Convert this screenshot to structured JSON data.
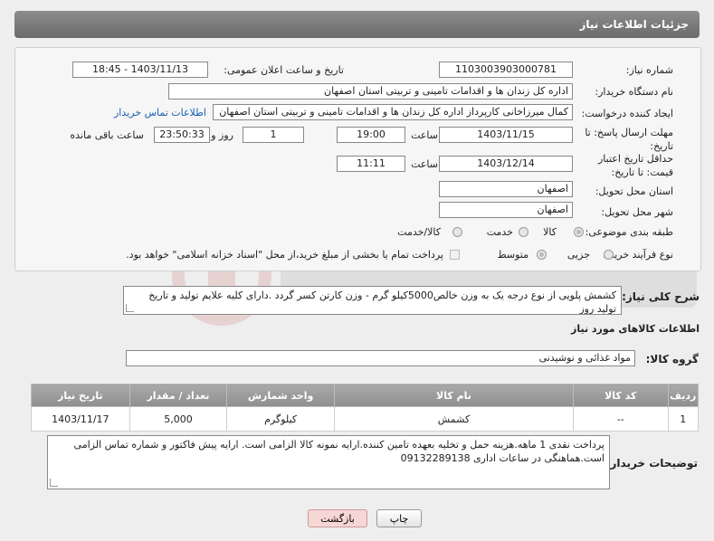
{
  "header": {
    "title": "جزئیات اطلاعات نیاز"
  },
  "form": {
    "need_number_label": "شماره نیاز:",
    "need_number": "1103003903000781",
    "announce_label": "تاریخ و ساعت اعلان عمومی:",
    "announce_value": "1403/11/13 - 18:45",
    "buyer_org_label": "نام دستگاه خریدار:",
    "buyer_org": "اداره کل زندان ها و اقدامات تامینی و تربیتی استان اصفهان",
    "creator_label": "ایجاد کننده درخواست:",
    "creator": "کمال میرزاخانی کارپرداز اداره کل زندان ها و اقدامات تامینی و تربیتی استان اصفهان",
    "contact_link": "اطلاعات تماس خریدار",
    "deadline_label": "مهلت ارسال پاسخ: تا تاریخ:",
    "deadline_date": "1403/11/15",
    "time_label": "ساعت",
    "deadline_time": "19:00",
    "days_value": "1",
    "days_label": "روز و",
    "remaining_value": "23:50:33",
    "remaining_label": "ساعت باقی مانده",
    "validity_label": "حداقل تاریخ اعتبار قیمت: تا تاریخ:",
    "validity_date": "1403/12/14",
    "validity_time": "11:11",
    "province_label": "استان محل تحویل:",
    "province": "اصفهان",
    "city_label": "شهر محل تحویل:",
    "city": "اصفهان",
    "category_label": "طبقه بندی موضوعی:",
    "category_options": [
      "کالا",
      "خدمت",
      "کالا/خدمت"
    ],
    "purchase_type_label": "نوع فرآیند خرید :",
    "purchase_type_options": [
      "جزیی",
      "متوسط"
    ],
    "payment_note": "پرداخت تمام یا بخشی از مبلغ خرید،از محل \"اسناد خزانه اسلامی\" خواهد بود."
  },
  "description": {
    "label": "شرح کلی نیاز:",
    "text": "کشمش پلویی از نوع درجه یک به وزن خالص5000کیلو گرم - وزن کارتن کسر گردد .دارای کلیه علایم تولید و تاریخ تولید روز"
  },
  "goods_info": {
    "title": "اطلاعات کالاهای مورد نیاز",
    "group_label": "گروه کالا:",
    "group_value": "مواد غذائی و نوشیدنی"
  },
  "table": {
    "headers": [
      "ردیف",
      "کد کالا",
      "نام کالا",
      "واحد شمارش",
      "تعداد / مقدار",
      "تاریخ نیاز"
    ],
    "rows": [
      [
        "1",
        "--",
        "کشمش",
        "کیلوگرم",
        "5,000",
        "1403/11/17"
      ]
    ]
  },
  "buyer_notes": {
    "label": "توضیحات خریدار:",
    "text": "پرداخت نقدی 1 ماهه.هزینه حمل و تخلیه بعهده تامین کننده.ارایه نمونه کالا الزامی است. ارایه پیش فاکتور و شماره تماس الزامی است.هماهنگی در ساعات اداری 09132289138"
  },
  "buttons": {
    "print": "چاپ",
    "back": "بازگشت"
  },
  "colors": {
    "header": "#7a7a7a",
    "link": "#1a5fb4",
    "back_button": "#f7d6d6"
  }
}
